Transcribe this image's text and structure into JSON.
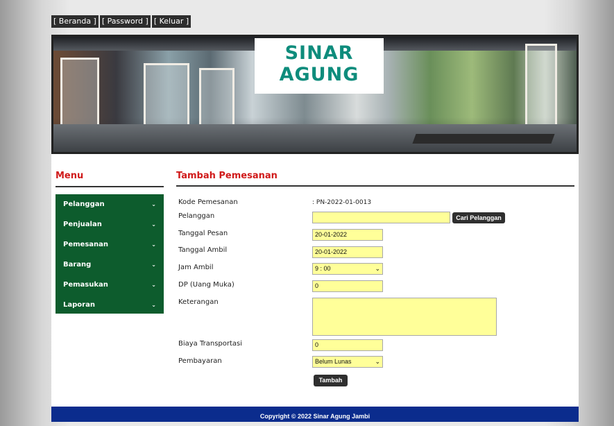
{
  "topnav": {
    "beranda": "[ Beranda ]",
    "password": "[ Password ]",
    "keluar": "[ Keluar ]"
  },
  "banner": {
    "line1": "SINAR",
    "line2": "AGUNG"
  },
  "sidebar": {
    "title": "Menu",
    "items": [
      {
        "label": "Pelanggan"
      },
      {
        "label": "Penjualan"
      },
      {
        "label": "Pemesanan"
      },
      {
        "label": "Barang"
      },
      {
        "label": "Pemasukan"
      },
      {
        "label": "Laporan"
      }
    ],
    "chevron": "⌄"
  },
  "form": {
    "title": "Tambah Pemesanan",
    "kode_label": "Kode Pemesanan",
    "kode_value": ": PN-2022-01-0013",
    "pelanggan_label": "Pelanggan",
    "pelanggan_value": "",
    "cari_button": "Cari Pelanggan",
    "tgl_pesan_label": "Tanggal Pesan",
    "tgl_pesan_value": "20-01-2022",
    "tgl_ambil_label": "Tanggal Ambil",
    "tgl_ambil_value": "20-01-2022",
    "jam_label": "Jam Ambil",
    "jam_value": "9 : 00",
    "dp_label": "DP (Uang Muka)",
    "dp_value": "0",
    "ket_label": "Keterangan",
    "ket_value": "",
    "biaya_label": "Biaya Transportasi",
    "biaya_value": "0",
    "bayar_label": "Pembayaran",
    "bayar_value": "Belum Lunas",
    "submit": "Tambah"
  },
  "footer": {
    "text": "Copyright © 2022 Sinar Agung Jambi"
  },
  "colors": {
    "accent": "#d01a1a",
    "menu_bg": "#0d5c2d",
    "footer_bg": "#0b2c8d",
    "field_bg": "#ffff99",
    "logo": "#0e8c7c"
  }
}
